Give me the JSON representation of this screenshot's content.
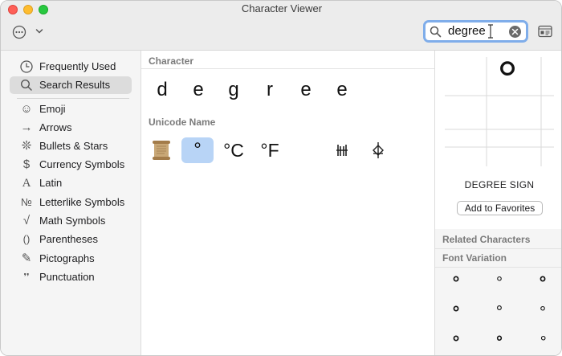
{
  "window": {
    "title": "Character Viewer"
  },
  "toolbar": {
    "more_icon": "ellipsis-circle-icon",
    "chevron_icon": "chevron-down-icon",
    "search_value": "degree",
    "search_icon": "magnifier-icon",
    "clear_icon": "clear-circle-icon",
    "card_icon": "keyboard-card-icon"
  },
  "sidebar": {
    "items": [
      {
        "label": "Frequently Used",
        "icon": "clock-icon",
        "glyph": ""
      },
      {
        "label": "Search Results",
        "icon": "search-icon",
        "glyph": ""
      },
      {
        "label": "Emoji",
        "icon": "smiley-icon",
        "glyph": "☺"
      },
      {
        "label": "Arrows",
        "icon": "arrow-icon",
        "glyph": "→"
      },
      {
        "label": "Bullets & Stars",
        "icon": "asterisk-icon",
        "glyph": "❊"
      },
      {
        "label": "Currency Symbols",
        "icon": "dollar-icon",
        "glyph": "$"
      },
      {
        "label": "Latin",
        "icon": "latin-a-icon",
        "glyph": "A"
      },
      {
        "label": "Letterlike Symbols",
        "icon": "numero-icon",
        "glyph": "№"
      },
      {
        "label": "Math Symbols",
        "icon": "sqrt-icon",
        "glyph": "√"
      },
      {
        "label": "Parentheses",
        "icon": "parentheses-icon",
        "glyph": "()"
      },
      {
        "label": "Pictographs",
        "icon": "pencil-icon",
        "glyph": "✎"
      },
      {
        "label": "Punctuation",
        "icon": "comma-quote-icon",
        "glyph": "❜❜"
      }
    ],
    "selected_index": 1
  },
  "main": {
    "character_header": "Character",
    "characters": [
      "d",
      "e",
      "g",
      "r",
      "e",
      "e"
    ],
    "unicode_header": "Unicode Name",
    "unicode_results": [
      {
        "glyph": "",
        "icon": "scroll-emoji-icon"
      },
      {
        "glyph": "°",
        "icon": ""
      },
      {
        "glyph": "°C",
        "icon": ""
      },
      {
        "glyph": "°F",
        "icon": ""
      },
      {
        "glyph": "",
        "icon": ""
      },
      {
        "glyph": "𓈗",
        "icon": "hieroglyph-icon"
      },
      {
        "glyph": "⛮",
        "icon": "compass-like-icon"
      }
    ],
    "selected_unicode_index": 1
  },
  "inspector": {
    "glyph": "°",
    "name": "DEGREE SIGN",
    "add_favorites_label": "Add to Favorites",
    "related_header": "Related Characters",
    "font_variation_header": "Font Variation",
    "font_variations": [
      "°",
      "°",
      "°",
      "°",
      "°",
      "°",
      "°",
      "°",
      "°"
    ]
  }
}
